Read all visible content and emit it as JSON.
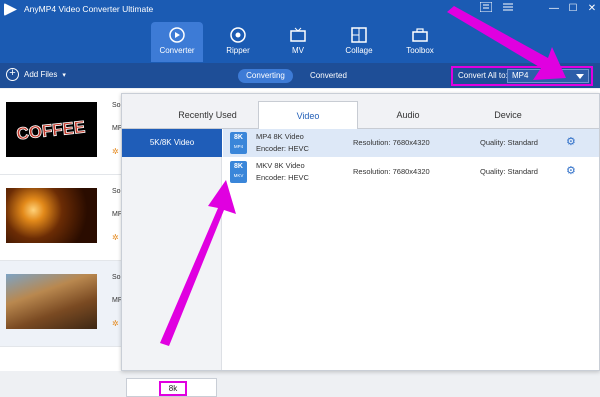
{
  "app": {
    "title": "AnyMP4 Video Converter Ultimate"
  },
  "window_controls": {
    "menu_icon": "menu-icon",
    "minimize": "—",
    "maximize": "☐",
    "close": "✕"
  },
  "nav": {
    "tabs": [
      {
        "label": "Converter",
        "icon": "converter-icon",
        "active": true
      },
      {
        "label": "Ripper",
        "icon": "disc-icon",
        "active": false
      },
      {
        "label": "MV",
        "icon": "mv-icon",
        "active": false
      },
      {
        "label": "Collage",
        "icon": "collage-icon",
        "active": false
      },
      {
        "label": "Toolbox",
        "icon": "toolbox-icon",
        "active": false
      }
    ]
  },
  "toolbar": {
    "add_files": "Add Files",
    "converting": "Converting",
    "converted": "Converted",
    "convert_all_label": "Convert All to:",
    "convert_all_value": "MP4"
  },
  "files": [
    {
      "thumb_text": "COFFEE",
      "line1": "So",
      "line2": "MP"
    },
    {
      "line1": "So",
      "line2": "MP"
    },
    {
      "line1": "So",
      "line2": "MP"
    }
  ],
  "format_panel": {
    "tabs": [
      "Recently Used",
      "Video",
      "Audio",
      "Device"
    ],
    "active_tab": "Video",
    "categories": [
      "5K/8K Video"
    ],
    "search_value": "8k",
    "formats": [
      {
        "icon_top": "8K",
        "icon_bottom": "MP4",
        "name": "MP4 8K Video",
        "encoder": "Encoder: HEVC",
        "resolution": "Resolution: 7680x4320",
        "quality": "Quality: Standard"
      },
      {
        "icon_top": "8K",
        "icon_bottom": "MKV",
        "name": "MKV 8K Video",
        "encoder": "Encoder: HEVC",
        "resolution": "Resolution: 7680x4320",
        "quality": "Quality: Standard"
      }
    ]
  },
  "colors": {
    "brand": "#1b5bb3",
    "toolbar": "#1e4e97",
    "highlight": "#e000e0",
    "selected": "#1f5db8"
  }
}
